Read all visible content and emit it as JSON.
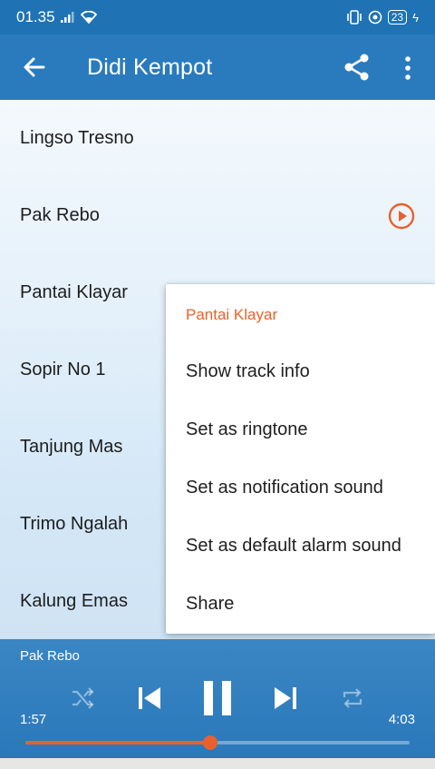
{
  "status_bar": {
    "time": "01.35",
    "battery": "23"
  },
  "app_bar": {
    "title": "Didi Kempot",
    "icons": [
      "back-arrow-icon",
      "share-icon",
      "more-vert-icon"
    ]
  },
  "tracks": [
    {
      "title": "Lingso Tresno"
    },
    {
      "title": "Pak Rebo",
      "playing": true
    },
    {
      "title": "Pantai Klayar"
    },
    {
      "title": "Sopir No 1"
    },
    {
      "title": "Tanjung Mas"
    },
    {
      "title": "Trimo Ngalah"
    },
    {
      "title": "Kalung Emas"
    }
  ],
  "context_menu": {
    "title": "Pantai Klayar",
    "items": [
      "Show track info",
      "Set as ringtone",
      "Set as notification sound",
      "Set as default alarm sound",
      "Share"
    ]
  },
  "player": {
    "now_playing": "Pak Rebo",
    "elapsed": "1:57",
    "duration": "4:03",
    "progress_fraction": 0.48,
    "icons": [
      "shuffle-icon",
      "previous-icon",
      "pause-icon",
      "next-icon",
      "repeat-icon"
    ]
  },
  "colors": {
    "primary": "#2a7bbd",
    "accent": "#e8612c"
  }
}
